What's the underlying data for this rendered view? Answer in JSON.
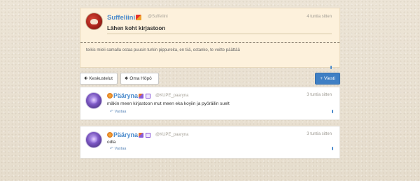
{
  "post": {
    "author": "Suffeliini",
    "handle": "@Suffeliini",
    "time": "4 tuntia sitten",
    "title": "Lähen koht kirjastoon",
    "body": "teikis mieli samalla ostaa puusin turkin pippureita, en tiiä, ostanko, te voitte päättää"
  },
  "toolbar": {
    "back_label": "Keskustelut",
    "profile_label": "Oma Höpö",
    "new_label": "Viesti",
    "back_icon": "arrow-left-icon",
    "profile_icon": "arrow-left-icon",
    "new_icon": "plus-icon"
  },
  "replies": [
    {
      "author": "Pääryna",
      "handle": "@KUPE_paaryna",
      "time": "3 tuntia sitten",
      "body": "mäkin meen kirjastoon mut meen eka koyiin ja pyöräilin suelt",
      "reply_label": "Vastaa"
    },
    {
      "author": "Pääryna",
      "handle": "@KUPE_paaryna",
      "time": "3 tuntia sitten",
      "body": "odla",
      "reply_label": "Vastaa"
    }
  ],
  "colors": {
    "accent": "#4a8acb",
    "primary_button": "#3f7fc4",
    "op_card_bg": "#fdf1dc"
  }
}
